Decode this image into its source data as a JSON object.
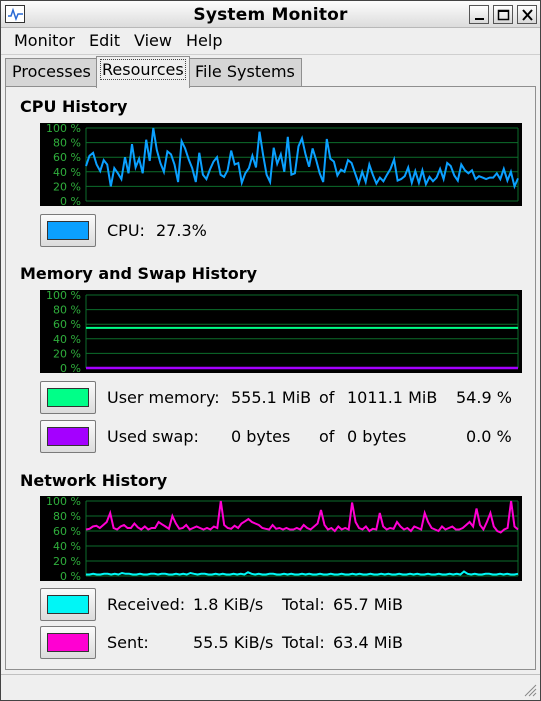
{
  "window": {
    "title": "System Monitor"
  },
  "menu": [
    "Monitor",
    "Edit",
    "View",
    "Help"
  ],
  "tabs": [
    "Processes",
    "Resources",
    "File Systems"
  ],
  "active_tab": 1,
  "graph_ticks": [
    "100 %",
    "80 %",
    "60 %",
    "40 %",
    "20 %",
    "0 %"
  ],
  "colors": {
    "cpu": "#0ba0ff",
    "user_memory": "#00ff88",
    "used_swap": "#a400ff",
    "received": "#00f6f6",
    "sent": "#ff00d2",
    "grid": "#0c6d2b",
    "tick_text": "#2fae3c"
  },
  "cpu": {
    "title": "CPU History",
    "label": "CPU:",
    "value": "27.3%",
    "history": [
      48,
      62,
      66,
      50,
      41,
      56,
      50,
      20,
      45,
      38,
      30,
      60,
      38,
      78,
      46,
      58,
      38,
      84,
      55,
      102,
      70,
      52,
      40,
      68,
      64,
      50,
      26,
      82,
      72,
      57,
      45,
      26,
      66,
      36,
      30,
      43,
      54,
      60,
      36,
      33,
      42,
      69,
      50,
      52,
      25,
      38,
      45,
      62,
      46,
      95,
      64,
      36,
      26,
      73,
      51,
      64,
      40,
      88,
      36,
      38,
      75,
      86,
      64,
      47,
      72,
      56,
      38,
      26,
      85,
      58,
      54,
      35,
      43,
      40,
      56,
      52,
      38,
      24,
      40,
      26,
      50,
      36,
      24,
      32,
      27,
      36,
      44,
      57,
      28,
      30,
      34,
      46,
      25,
      41,
      25,
      42,
      23,
      33,
      27,
      32,
      44,
      30,
      52,
      48,
      35,
      28,
      50,
      42,
      38,
      42,
      30,
      34,
      32,
      30,
      32,
      32,
      38,
      30,
      44,
      28,
      40,
      20,
      31
    ]
  },
  "memory": {
    "title": "Memory and Swap History",
    "user_label": "User memory:",
    "user_used": "555.1 MiB",
    "of_text": "of",
    "user_total": "1011.1 MiB",
    "user_percent": "54.9 %",
    "swap_label": "Used swap:",
    "swap_used": "0 bytes",
    "swap_total": "0 bytes",
    "swap_percent": "0.0 %",
    "user_level": 0.549,
    "swap_level": 0.0
  },
  "network": {
    "title": "Network History",
    "received_label": "Received:",
    "received_rate": "1.8 KiB/s",
    "total_label": "Total:",
    "received_total": "65.7 MiB",
    "sent_label": "Sent:",
    "sent_rate": "55.5 KiB/s",
    "sent_total": "63.4 MiB",
    "sent_history": [
      62,
      63,
      66,
      67,
      64,
      68,
      72,
      84,
      64,
      62,
      66,
      68,
      64,
      64,
      70,
      65,
      62,
      66,
      62,
      64,
      64,
      72,
      69,
      66,
      63,
      80,
      70,
      63,
      64,
      68,
      62,
      64,
      66,
      64,
      62,
      64,
      62,
      66,
      64,
      104,
      68,
      64,
      63,
      67,
      64,
      70,
      73,
      76,
      72,
      70,
      68,
      64,
      63,
      62,
      68,
      63,
      64,
      62,
      64,
      62,
      62,
      64,
      62,
      68,
      64,
      62,
      66,
      70,
      88,
      68,
      62,
      64,
      60,
      66,
      62,
      64,
      62,
      98,
      72,
      64,
      62,
      66,
      60,
      63,
      62,
      84,
      66,
      62,
      64,
      63,
      72,
      66,
      62,
      64,
      60,
      66,
      64,
      62,
      84,
      72,
      64,
      62,
      60,
      66,
      62,
      64,
      66,
      62,
      62,
      64,
      68,
      72,
      66,
      90,
      68,
      62,
      72,
      84,
      66,
      60,
      58,
      62,
      64,
      100,
      66,
      62
    ],
    "received_history": [
      2,
      2,
      3,
      2,
      2,
      3,
      3,
      2,
      3,
      2,
      4,
      3,
      3,
      2,
      2,
      3,
      2,
      2,
      3,
      3,
      2,
      3,
      3,
      2,
      2,
      3,
      2,
      3,
      2,
      4,
      3,
      2,
      3,
      3,
      2,
      2,
      3,
      2,
      3,
      2,
      2,
      3,
      2,
      3,
      2,
      5,
      3,
      2,
      3,
      2,
      2,
      3,
      3,
      2,
      2,
      3,
      2,
      3,
      2,
      2,
      3,
      2,
      3,
      2,
      2,
      3,
      2,
      2,
      3,
      2,
      2,
      3,
      2,
      2,
      3,
      2,
      3,
      2,
      2,
      3,
      2,
      2,
      3,
      2,
      3,
      2,
      2,
      3,
      2,
      2,
      3,
      2,
      3,
      2,
      2,
      3,
      2,
      2,
      3,
      2,
      2,
      3,
      2,
      3,
      2,
      6,
      3,
      2,
      3,
      2,
      2,
      3,
      3,
      2,
      2,
      3,
      2,
      3,
      2,
      2,
      3
    ]
  }
}
